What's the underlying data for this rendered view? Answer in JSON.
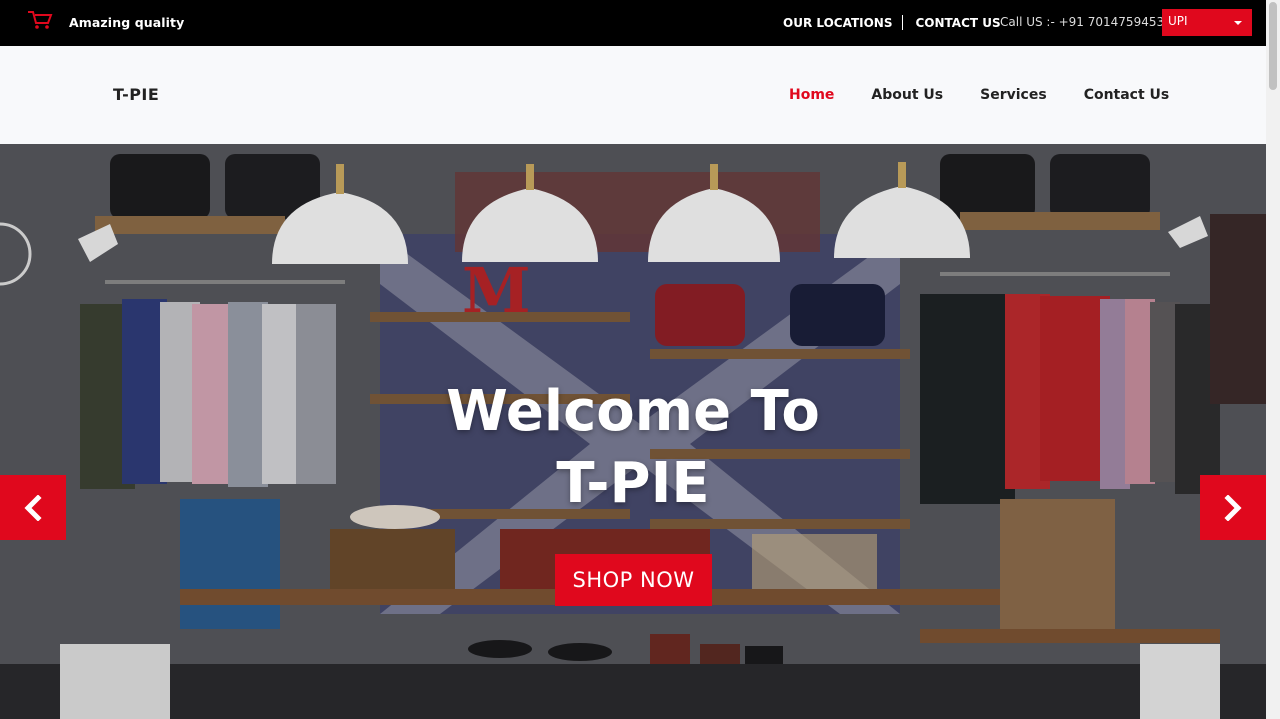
{
  "topbar": {
    "tagline": "Amazing quality",
    "our_locations": "OUR LOCATIONS",
    "contact_us": "CONTACT US",
    "call_us": "Call US :- +91 7014759453",
    "payment_select": "UPI",
    "icons": {
      "logo": "cart-icon",
      "select": "chevron-down-icon"
    }
  },
  "nav": {
    "brand": "T-PIE",
    "items": [
      {
        "label": "Home",
        "active": true
      },
      {
        "label": "About Us",
        "active": false
      },
      {
        "label": "Services",
        "active": false
      },
      {
        "label": "Contact Us",
        "active": false
      }
    ]
  },
  "hero": {
    "title_line1": "Welcome To",
    "title_line2": "T-PIE",
    "cta": "SHOP NOW",
    "icons": {
      "prev": "chevron-left-icon",
      "next": "chevron-right-icon"
    }
  },
  "colors": {
    "accent": "#e0081d",
    "topbar_bg": "#000000",
    "nav_bg": "#f8f9fb"
  }
}
